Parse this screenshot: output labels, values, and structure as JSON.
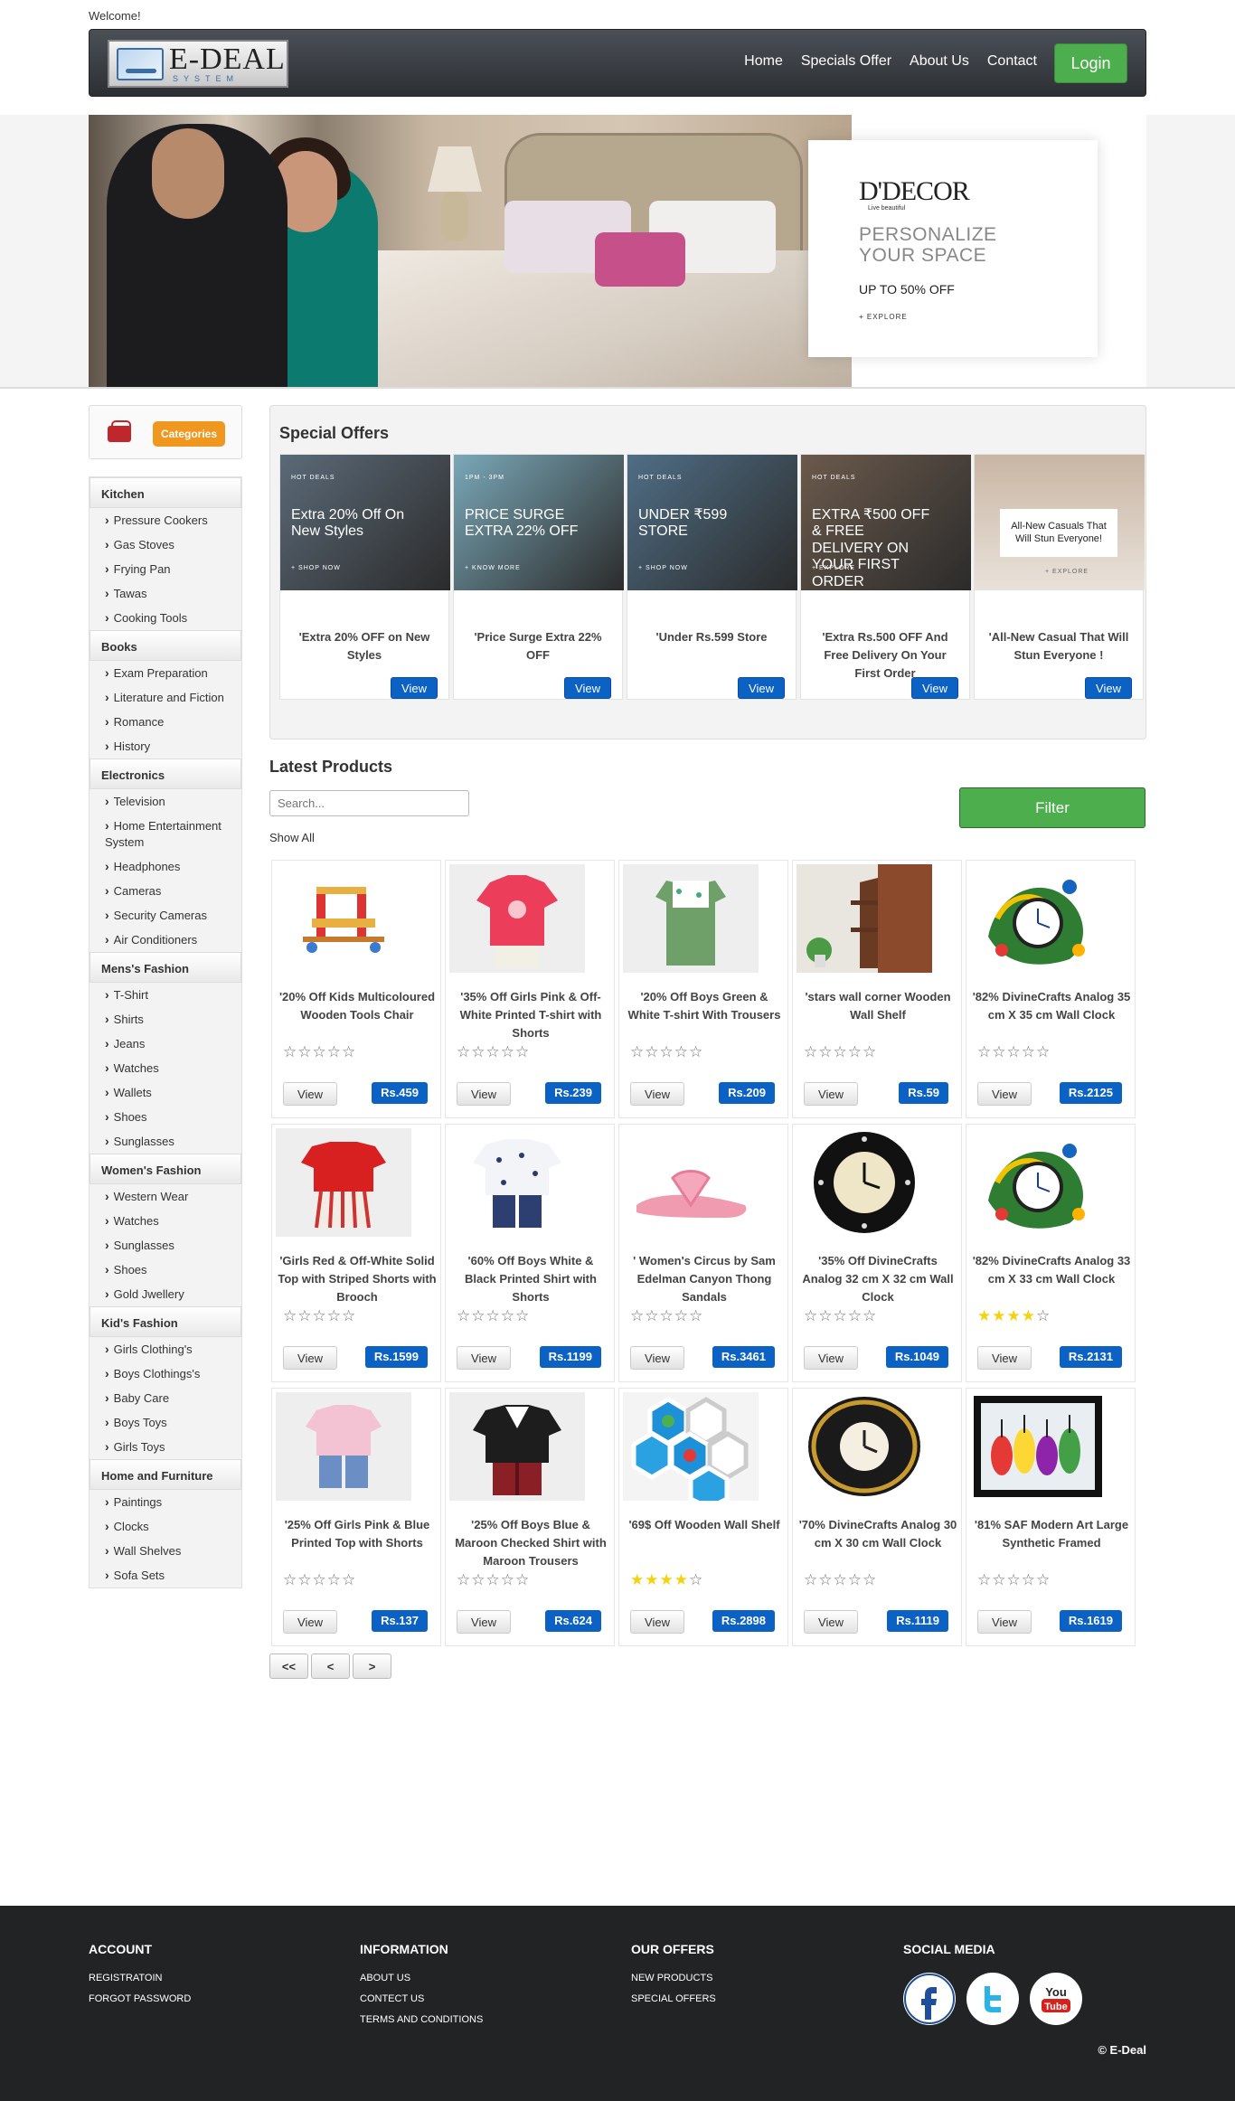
{
  "header": {
    "welcome": "Welcome!",
    "logo_main": "E-DEAL",
    "logo_sub": "SYSTEM",
    "nav": [
      "Home",
      "Specials Offer",
      "About Us",
      "Contact"
    ],
    "login": "Login"
  },
  "banner": {
    "brand": "D'DECOR",
    "tagline": "Live beautiful",
    "headline": "PERSONALIZE YOUR SPACE",
    "offer": "UP TO 50% OFF",
    "explore": "+ EXPLORE"
  },
  "sidebar": {
    "categories_button": "Categories",
    "groups": [
      {
        "title": "Kitchen",
        "items": [
          "Pressure Cookers",
          "Gas Stoves",
          "Frying Pan",
          "Tawas",
          "Cooking Tools"
        ]
      },
      {
        "title": "Books",
        "items": [
          "Exam Preparation",
          "Literature and Fiction",
          "Romance",
          "History"
        ]
      },
      {
        "title": "Electronics",
        "items": [
          "Television",
          "Home Entertainment System",
          "Headphones",
          "Cameras",
          "Security Cameras",
          "Air Conditioners"
        ]
      },
      {
        "title": "Mens's Fashion",
        "items": [
          "T-Shirt",
          "Shirts",
          "Jeans",
          "Watches",
          "Wallets",
          "Shoes",
          "Sunglasses"
        ]
      },
      {
        "title": "Women's Fashion",
        "items": [
          "Western Wear",
          "Watches",
          "Sunglasses",
          "Shoes",
          "Gold Jwellery"
        ]
      },
      {
        "title": "Kid's Fashion",
        "items": [
          "Girls Clothing's",
          "Boys Clothings's",
          "Baby Care",
          "Boys Toys",
          "Girls Toys"
        ]
      },
      {
        "title": "Home and Furniture",
        "items": [
          "Paintings",
          "Clocks",
          "Wall Shelves",
          "Sofa Sets"
        ]
      }
    ]
  },
  "offers": {
    "title": "Special Offers",
    "view_label": "View",
    "items": [
      {
        "hot": "HOT DEALS",
        "text": "Extra 20% Off On New Styles",
        "link": "+ SHOP NOW",
        "label": "'Extra 20% OFF on New Styles",
        "bg": "#5b6a78"
      },
      {
        "hot": "1PM - 3PM",
        "text": "PRICE SURGE EXTRA 22% OFF",
        "link": "+ KNOW MORE",
        "label": "'Price Surge Extra 22% OFF",
        "bg": "#7aa8b8"
      },
      {
        "hot": "HOT DEALS",
        "text": "UNDER ₹599 STORE",
        "link": "+ SHOP NOW",
        "label": "'Under Rs.599 Store",
        "bg": "#4f6e86"
      },
      {
        "hot": "HOT DEALS",
        "text": "EXTRA ₹500 OFF & FREE DELIVERY ON YOUR FIRST ORDER",
        "link": "+ EXPLORE",
        "label": "'Extra Rs.500 OFF And Free Delivery On Your First Order",
        "bg": "#6b5a4c"
      },
      {
        "hot": "",
        "text": "All-New Casuals That Will Stun Everyone!",
        "link": "+ EXPLORE",
        "label": "'All-New Casual That Will Stun Everyone !",
        "bg": "#c9b6a4"
      }
    ]
  },
  "latest": {
    "title": "Latest Products",
    "search_placeholder": "Search...",
    "filter": "Filter",
    "show_all": "Show All",
    "view_label": "View",
    "products": [
      {
        "title": "'20% Off Kids Multicoloured Wooden Tools Chair",
        "price": "Rs.459",
        "rating": 0,
        "img": "chair"
      },
      {
        "title": "'35% Off Girls Pink & Off-White Printed T-shirt with Shorts",
        "price": "Rs.239",
        "rating": 0,
        "img": "tshirt"
      },
      {
        "title": "'20% Off Boys Green & White T-shirt With Trousers",
        "price": "Rs.209",
        "rating": 0,
        "img": "overall"
      },
      {
        "title": "'stars wall corner Wooden Wall Shelf",
        "price": "Rs.59",
        "rating": 0,
        "img": "shelf"
      },
      {
        "title": "'82% DivineCrafts Analog 35 cm X 35 cm Wall Clock",
        "price": "Rs.2125",
        "rating": 0,
        "img": "peacock"
      },
      {
        "title": "'Girls Red & Off-White Solid Top with Striped Shorts with Brooch",
        "price": "Rs.1599",
        "rating": 0,
        "img": "redtop"
      },
      {
        "title": "'60% Off Boys White & Black Printed Shirt with Shorts",
        "price": "Rs.1199",
        "rating": 0,
        "img": "boyshirt"
      },
      {
        "title": "' Women's Circus by Sam Edelman Canyon Thong Sandals",
        "price": "Rs.3461",
        "rating": 0,
        "img": "sandal"
      },
      {
        "title": "'35% Off DivineCrafts Analog 32 cm X 32 cm Wall Clock",
        "price": "Rs.1049",
        "rating": 0,
        "img": "blackclock"
      },
      {
        "title": "'82% DivineCrafts Analog 33 cm X 33 cm Wall Clock",
        "price": "Rs.2131",
        "rating": 4,
        "img": "peacock2"
      },
      {
        "title": "'25% Off Girls Pink & Blue Printed Top with Shorts",
        "price": "Rs.137",
        "rating": 0,
        "img": "pinktop"
      },
      {
        "title": "'25% Off Boys Blue & Maroon Checked Shirt with Maroon Trousers",
        "price": "Rs.624",
        "rating": 0,
        "img": "suit"
      },
      {
        "title": "'69$ Off Wooden Wall Shelf",
        "price": "Rs.2898",
        "rating": 4,
        "img": "hexshelf"
      },
      {
        "title": "'70% DivineCrafts Analog 30 cm X 30 cm Wall Clock",
        "price": "Rs.1119",
        "rating": 0,
        "img": "goldclock"
      },
      {
        "title": "'81% SAF Modern Art Large Synthetic Framed",
        "price": "Rs.1619",
        "rating": 0,
        "img": "painting"
      }
    ],
    "pager": [
      "<<",
      "<",
      ">"
    ]
  },
  "footer": {
    "account": {
      "title": "ACCOUNT",
      "links": [
        "REGISTRATOIN",
        "FORGOT PASSWORD"
      ]
    },
    "information": {
      "title": "INFORMATION",
      "links": [
        "ABOUT US",
        "CONTECT US",
        "TERMS AND CONDITIONS"
      ]
    },
    "offers": {
      "title": "OUR OFFERS",
      "links": [
        "NEW PRODUCTS",
        "SPECIAL OFFERS"
      ]
    },
    "social": {
      "title": "SOCIAL MEDIA",
      "icons": [
        "facebook-icon",
        "twitter-icon",
        "youtube-icon"
      ]
    },
    "copyright": "© E-Deal"
  },
  "colors": {
    "accent_blue": "#0b62c4",
    "accent_green": "#4cae4c",
    "accent_orange": "#f0971f",
    "footer_bg": "#222325"
  }
}
